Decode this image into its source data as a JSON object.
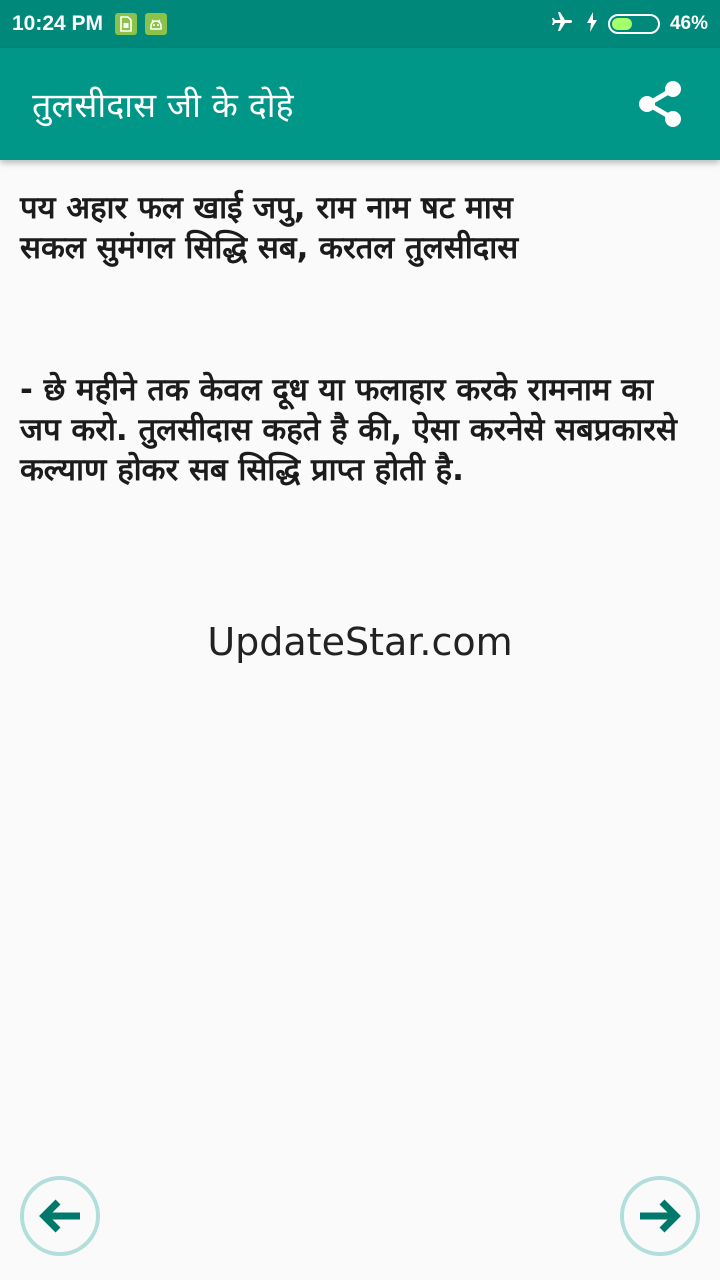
{
  "status_bar": {
    "time": "10:24 PM",
    "battery": "46%",
    "battery_level": 0.46,
    "icons": [
      "sim-icon",
      "android-icon",
      "airplane-icon",
      "charging-icon",
      "battery-icon"
    ]
  },
  "app_bar": {
    "title": "तुलसीदास जी के दोहे",
    "share_icon": "share-icon",
    "color": "#009688"
  },
  "doha": {
    "text": "पय अहार फल खाई जपु, राम नाम षट मास\nसकल सुमंगल सिद्धि सब, करतल तुलसीदास"
  },
  "meaning": {
    "text": "- छे महीने तक केवल दूध या फलाहार करके रामनाम का जप करो. तुलसीदास कहते है की, ऐसा करनेसे सबप्रकारसे कल्याण होकर सब सिद्धि प्राप्त होती है."
  },
  "source": {
    "text": "UpdateStar.com"
  },
  "navigation": {
    "prev_icon": "arrow-left-icon",
    "next_icon": "arrow-right-icon",
    "ring_color": "#b2dfdb",
    "arrow_color": "#00796b"
  }
}
